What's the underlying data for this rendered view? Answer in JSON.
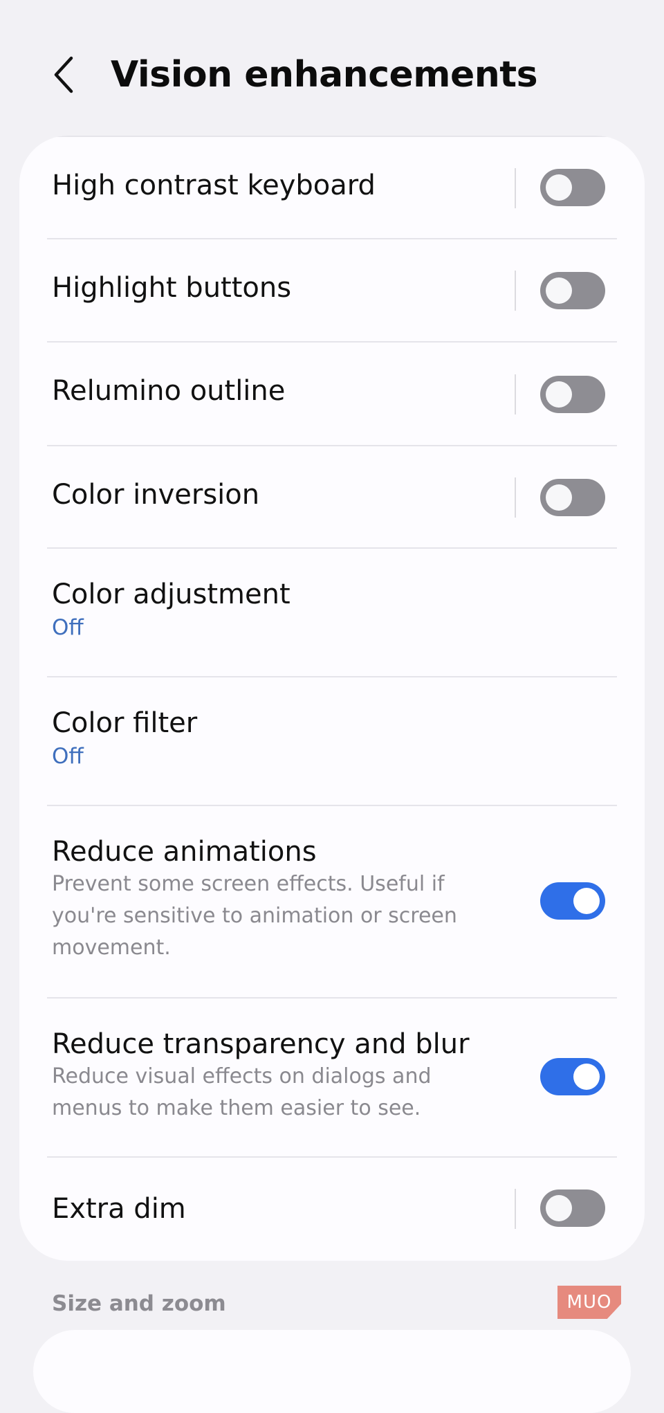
{
  "header": {
    "title": "Vision enhancements",
    "back_icon": "chevron-left-icon"
  },
  "settings": [
    {
      "title": "High contrast keyboard",
      "type": "toggle",
      "on": false
    },
    {
      "title": "Highlight buttons",
      "type": "toggle",
      "on": false
    },
    {
      "title": "Relumino outline",
      "type": "toggle",
      "on": false
    },
    {
      "title": "Color inversion",
      "type": "toggle",
      "on": false
    },
    {
      "title": "Color adjustment",
      "type": "link",
      "status": "Off"
    },
    {
      "title": "Color filter",
      "type": "link",
      "status": "Off"
    },
    {
      "title": "Reduce animations",
      "type": "toggle",
      "on": true,
      "description": "Prevent some screen effects. Useful if you're sensitive to animation or screen movement."
    },
    {
      "title": "Reduce transparency and blur",
      "type": "toggle",
      "on": true,
      "description": "Reduce visual effects on dialogs and menus to make them easier to see."
    },
    {
      "title": "Extra dim",
      "type": "toggle",
      "on": false
    }
  ],
  "section": {
    "title": "Size and zoom"
  },
  "watermark": "MUO",
  "colors": {
    "background": "#f2f1f5",
    "card": "#fdfcff",
    "accent": "#2f6fe8",
    "status_link": "#3f6fbd",
    "toggle_off": "#8e8d93",
    "secondary_text": "#8a898f"
  }
}
